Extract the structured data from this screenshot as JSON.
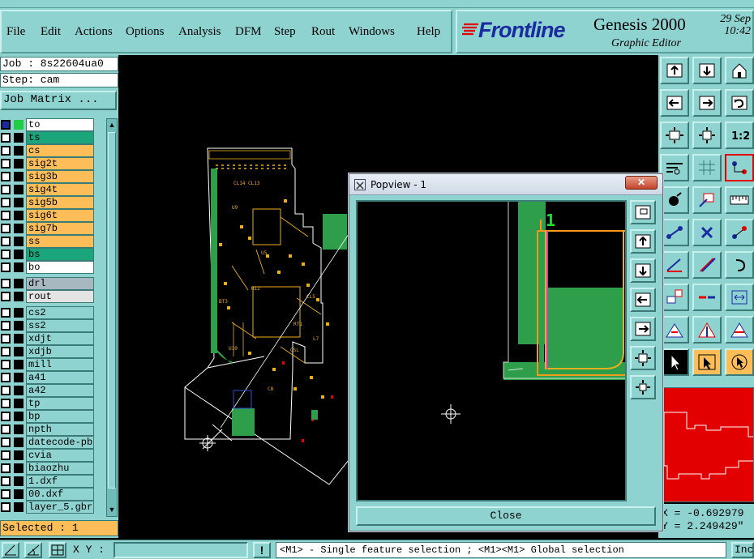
{
  "menubar": {
    "items": [
      "File",
      "Edit",
      "Actions",
      "Options",
      "Analysis",
      "DFM",
      "Step",
      "Rout",
      "Windows",
      "Help"
    ]
  },
  "brand": {
    "logo_text": "Frontline",
    "product": "Genesis 2000",
    "subtitle": "Graphic Editor",
    "date": "29 Sep",
    "time": "10:42"
  },
  "left": {
    "job": "Job : 8s22604ua0",
    "step": "Step: cam",
    "job_matrix": "Job Matrix ...",
    "layers": [
      {
        "name": "to",
        "color": "#ffffff"
      },
      {
        "name": "ts",
        "color": "#1aa57a"
      },
      {
        "name": "cs",
        "color": "#fdbe5a"
      },
      {
        "name": "sig2t",
        "color": "#fdbe5a"
      },
      {
        "name": "sig3b",
        "color": "#fdbe5a"
      },
      {
        "name": "sig4t",
        "color": "#fdbe5a"
      },
      {
        "name": "sig5b",
        "color": "#fdbe5a"
      },
      {
        "name": "sig6t",
        "color": "#fdbe5a"
      },
      {
        "name": "sig7b",
        "color": "#fdbe5a"
      },
      {
        "name": "ss",
        "color": "#fdbe5a"
      },
      {
        "name": "bs",
        "color": "#1aa57a"
      },
      {
        "name": "bo",
        "color": "#ffffff"
      },
      {
        "name": "drl",
        "color": "#a8b8c0"
      },
      {
        "name": "rout",
        "color": "#e4e4e4"
      },
      {
        "name": "cs2",
        "color": "#8fd3d0"
      },
      {
        "name": "ss2",
        "color": "#8fd3d0"
      },
      {
        "name": "xdjt",
        "color": "#8fd3d0"
      },
      {
        "name": "xdjb",
        "color": "#8fd3d0"
      },
      {
        "name": "mill",
        "color": "#8fd3d0"
      },
      {
        "name": "a41",
        "color": "#8fd3d0"
      },
      {
        "name": "a42",
        "color": "#8fd3d0"
      },
      {
        "name": "tp",
        "color": "#8fd3d0"
      },
      {
        "name": "bp",
        "color": "#8fd3d0"
      },
      {
        "name": "npth",
        "color": "#8fd3d0"
      },
      {
        "name": "datecode-pbe",
        "color": "#8fd3d0"
      },
      {
        "name": "cvia",
        "color": "#8fd3d0"
      },
      {
        "name": "biaozhu",
        "color": "#8fd3d0"
      },
      {
        "name": "1.dxf",
        "color": "#8fd3d0"
      },
      {
        "name": "00.dxf",
        "color": "#8fd3d0"
      },
      {
        "name": "layer_5.gbr",
        "color": "#8fd3d0"
      }
    ],
    "selected": "Selected : 1"
  },
  "status": {
    "xy_label": "X Y :",
    "warn": "!",
    "message": "<M1> - Single feature selection ; <M1><M1> Global selection",
    "inc": "Inc"
  },
  "coords": {
    "x": "X = -0.692979",
    "y": "Y = 2.249429\""
  },
  "popview": {
    "title": "Popview - 1",
    "close_x": "✕",
    "close_button": "Close",
    "marker_label": "1"
  },
  "colors": {
    "panel": "#8fd3d0",
    "trace_green": "#2e9e4a",
    "outline_yellow": "#e8b020",
    "highlight_orange": "#f39a1a",
    "accent_red": "#e30000"
  }
}
